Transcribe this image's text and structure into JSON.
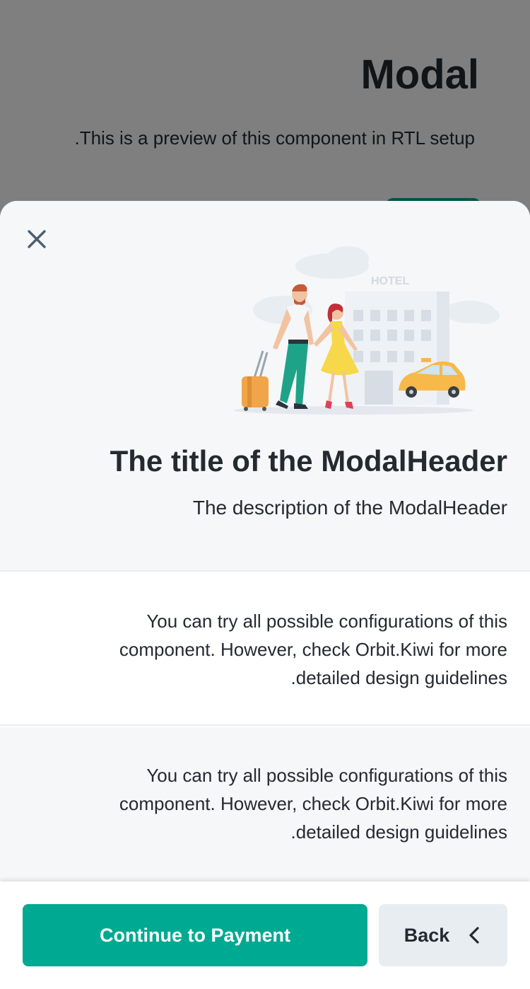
{
  "background_page": {
    "title": "Modal",
    "description": "This is a preview of this component in RTL setup."
  },
  "modal": {
    "close_icon": "close-icon",
    "illustration": {
      "name": "hotel-couple-taxi-illustration",
      "sign_text": "HOTEL"
    },
    "header": {
      "title": "The title of the ModalHeader",
      "description": "The description of the ModalHeader"
    },
    "sections": [
      {
        "text": "You can try all possible configurations of this component. However, check Orbit.Kiwi for more detailed design guidelines."
      },
      {
        "text": "You can try all possible configurations of this component. However, check Orbit.Kiwi for more detailed design guidelines."
      }
    ],
    "footer": {
      "primary_label": "Continue to Payment",
      "secondary_label": "Back",
      "secondary_icon": "chevron-left-icon"
    }
  },
  "colors": {
    "primary": "#00a991",
    "text": "#252a31",
    "header_bg": "#f5f7f9",
    "secondary_bg": "#e8edf1",
    "overlay": "rgba(0,0,0,0.5)"
  }
}
